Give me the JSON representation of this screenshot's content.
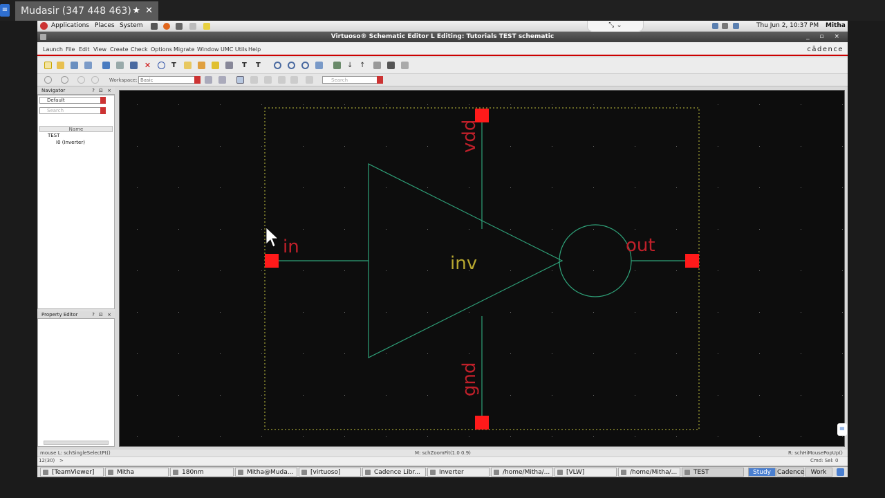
{
  "teamviewer": {
    "tab_title": "Mudasir (347 448 463)",
    "star": "★",
    "close": "✕",
    "logo": "≡"
  },
  "panel": {
    "menus": [
      "Applications",
      "Places",
      "System"
    ],
    "clock": "Thu Jun  2, 10:37 PM",
    "user": "Mitha",
    "tv_controls": "⤡  ⌄"
  },
  "window": {
    "title": "Virtuoso® Schematic Editor L Editing: Tutorials TEST schematic",
    "buttons": "_ ▫ ×"
  },
  "menubar": {
    "items": [
      "Launch",
      "File",
      "Edit",
      "View",
      "Create",
      "Check",
      "Options",
      "Migrate",
      "Window",
      "UMC Utils",
      "Help"
    ],
    "logo": "cādence"
  },
  "toolbar2": {
    "workspace_label": "Workspace:",
    "workspace_value": "Basic",
    "search_placeholder": "Search"
  },
  "navigator": {
    "title": "Navigator",
    "title_buttons": "? ⊡ ×",
    "filter_value": "Default",
    "search_placeholder": "Search",
    "column_header": "Name",
    "tree": [
      "TEST",
      "I0 (Inverter)"
    ]
  },
  "property_editor": {
    "title": "Property Editor",
    "title_buttons": "? ⊡ ×"
  },
  "schematic": {
    "symbol_label": "inv",
    "pins": {
      "vdd": "vdd",
      "gnd": "gnd",
      "in": "in",
      "out": "out"
    },
    "colors": {
      "background": "#0d0d0d",
      "wire": "#2fa37a",
      "pin": "#ff1a1a",
      "pin_label": "#c0202a",
      "instance_label": "#b8a830",
      "boundary": "#c8c840",
      "grid_dot": "#7a7a7a"
    }
  },
  "status": {
    "left": "mouse L: schSingleSelectPt()",
    "middle": "M: schZoomFit(1.0 0.9)",
    "right": "R: schHiMousePopUp()",
    "prompt_num": "12(30)",
    "prompt": ">",
    "cmd": "Cmd: Sel: 0"
  },
  "taskbar": {
    "tasks": [
      "[TeamViewer]",
      "Mitha",
      "180nm",
      "Mitha@Muda...",
      "[virtuoso]",
      "Cadence Libr...",
      "Inverter",
      "/home/Mitha/...",
      "[VLW]",
      "/home/Mitha/...",
      "TEST"
    ],
    "workspaces": [
      "Study",
      "Cadence",
      "Work"
    ]
  }
}
